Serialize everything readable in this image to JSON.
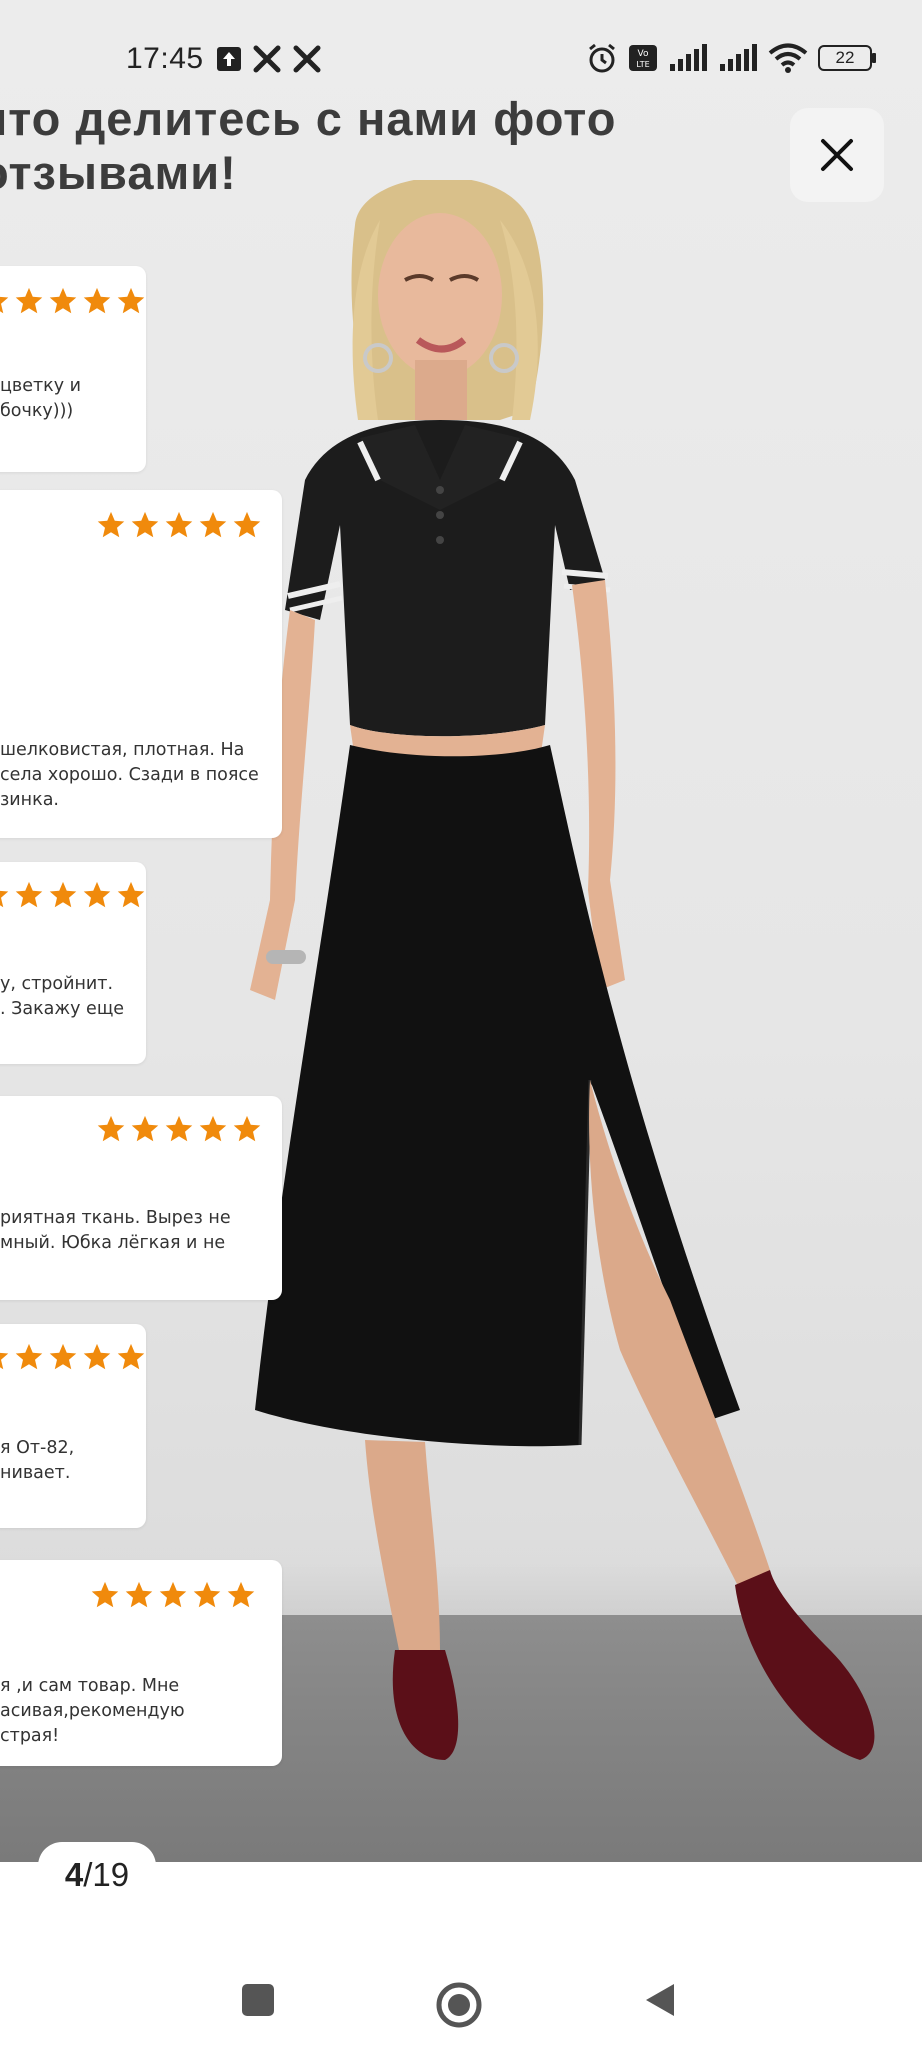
{
  "status_bar": {
    "time": "17:45",
    "left_icons": [
      "upload-arrow-icon",
      "tools-icon",
      "tools-icon"
    ],
    "right_icons": [
      "alarm-icon",
      "volte-icon",
      "signal-icon",
      "signal-icon",
      "wifi-icon"
    ],
    "volte_label": "Vo\nLTE",
    "battery": "22"
  },
  "heading": {
    "line1": "что делитесь с нами фото",
    "line2": "отзывами!"
  },
  "reviews": [
    {
      "stars": 5,
      "text": "цветку и\nбочку)))"
    },
    {
      "stars": 5,
      "text": "шелковистая, плотная. На\nсела хорошо. Сзади в поясе\nзинка."
    },
    {
      "stars": 5,
      "text": "у, стройнит.\n. Закажу еще"
    },
    {
      "stars": 5,
      "text": "риятная ткань. Вырез не\nмный. Юбка лёгкая и не"
    },
    {
      "stars": 5,
      "text": "я От-82,\nнивает."
    },
    {
      "stars": 5,
      "text": "я ,и сам товар. Мне\nасивая,рекомендую\nстрая!"
    }
  ],
  "pager": {
    "current": "4",
    "separator": " / ",
    "total": "19"
  },
  "colors": {
    "star": "#f08a0c",
    "text": "#333333",
    "heading": "#3c3c3c"
  },
  "navbar": {
    "buttons": [
      "recents-square-icon",
      "home-circle-icon",
      "back-triangle-icon"
    ]
  }
}
